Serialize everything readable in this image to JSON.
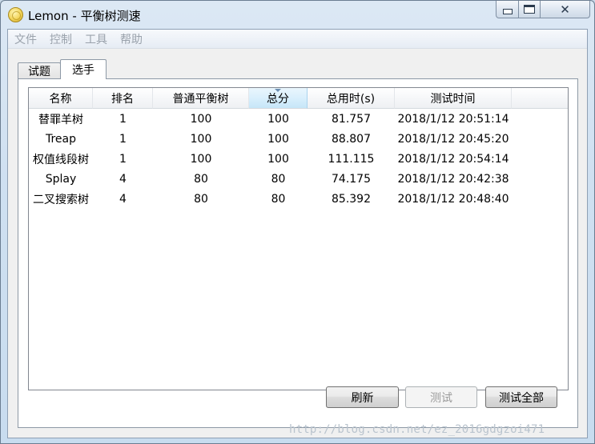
{
  "window": {
    "title": "Lemon - 平衡树测速",
    "icon": "lemon-app-icon"
  },
  "menu": [
    "文件",
    "控制",
    "工具",
    "帮助"
  ],
  "tabs": [
    {
      "label": "试题",
      "active": false
    },
    {
      "label": "选手",
      "active": true
    }
  ],
  "table": {
    "columns": [
      "名称",
      "排名",
      "普通平衡树",
      "总分",
      "总用时(s)",
      "测试时间"
    ],
    "sorted_column": "总分",
    "rows": [
      [
        "替罪羊树",
        "1",
        "100",
        "100",
        "81.757",
        "2018/1/12 20:51:14"
      ],
      [
        "Treap",
        "1",
        "100",
        "100",
        "88.807",
        "2018/1/12 20:45:20"
      ],
      [
        "权值线段树",
        "1",
        "100",
        "100",
        "111.115",
        "2018/1/12 20:54:14"
      ],
      [
        "Splay",
        "4",
        "80",
        "80",
        "74.175",
        "2018/1/12 20:42:38"
      ],
      [
        "二叉搜索树",
        "4",
        "80",
        "80",
        "85.392",
        "2018/1/12 20:48:40"
      ]
    ]
  },
  "buttons": {
    "refresh": "刷新",
    "test": "测试",
    "test_all": "测试全部"
  },
  "watermark": "http://blog.csdn.net/ez_2016gdgzoi471"
}
